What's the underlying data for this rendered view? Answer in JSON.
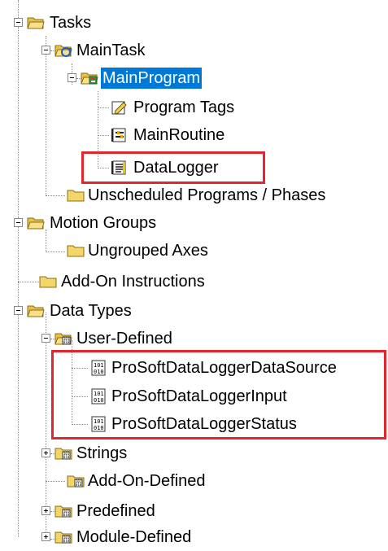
{
  "tree": {
    "tasks": {
      "label": "Tasks",
      "main_task": {
        "label": "MainTask",
        "main_program": {
          "label": "MainProgram",
          "children": [
            "Program Tags",
            "MainRoutine",
            "DataLogger"
          ]
        }
      },
      "unscheduled": "Unscheduled Programs / Phases"
    },
    "motion_groups": {
      "label": "Motion Groups",
      "ungrouped_axes": "Ungrouped Axes"
    },
    "add_on_instructions": "Add-On Instructions",
    "data_types": {
      "label": "Data Types",
      "user_defined": {
        "label": "User-Defined",
        "children": [
          "ProSoftDataLoggerDataSource",
          "ProSoftDataLoggerInput",
          "ProSoftDataLoggerStatus"
        ]
      },
      "strings": "Strings",
      "add_on_defined": "Add-On-Defined",
      "predefined": "Predefined",
      "module_defined": "Module-Defined"
    }
  },
  "colors": {
    "selection": "#0078d7",
    "highlight_border": "#e3262c",
    "folder": "#f5d66b"
  }
}
